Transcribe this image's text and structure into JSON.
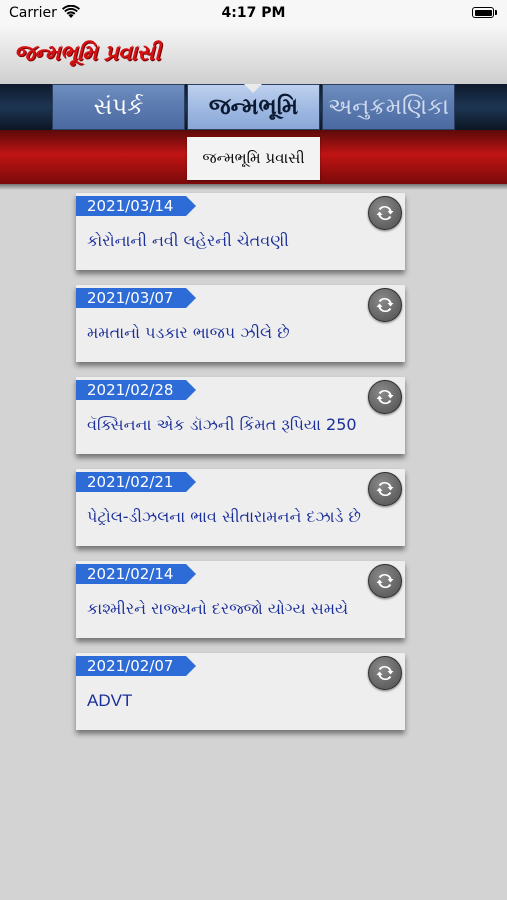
{
  "status_bar": {
    "carrier": "Carrier",
    "time": "4:17 PM"
  },
  "header": {
    "logo_text": "જન્મભૂમિ પ્રવાસી"
  },
  "tabs": [
    {
      "label": "સંપર્ક",
      "active": false
    },
    {
      "label": "જન્મભૂમિ",
      "active": true
    },
    {
      "label": "અનુક્રમણિકા",
      "active": false
    }
  ],
  "section": {
    "label": "જન્મભૂમિ પ્રવાસી"
  },
  "items": [
    {
      "date": "2021/03/14",
      "title": "કોરોનાની નવી લહેરની ચેતવણી"
    },
    {
      "date": "2021/03/07",
      "title": "મમતાનો પડકાર ભાજપ ઝીલે છે"
    },
    {
      "date": "2021/02/28",
      "title": "વૅક્સિનના એક ડૉઝની કિંમત રૂપિયા 250"
    },
    {
      "date": "2021/02/21",
      "title": "પેટ્રોલ-ડીઝલના ભાવ સીતારામનને દઝાડે છે"
    },
    {
      "date": "2021/02/14",
      "title": "કાશ્મીરને રાજ્યનો દરજ્જો યોગ્ય સમયે"
    },
    {
      "date": "2021/02/07",
      "title": "ADVT"
    }
  ],
  "colors": {
    "date_tag": "#2d6bd6",
    "title_text": "#1b2f9a",
    "red_bar": "#c01414",
    "logo": "#d41215"
  },
  "icons": {
    "wifi": "wifi-icon",
    "battery": "battery-icon",
    "refresh": "refresh-icon"
  }
}
